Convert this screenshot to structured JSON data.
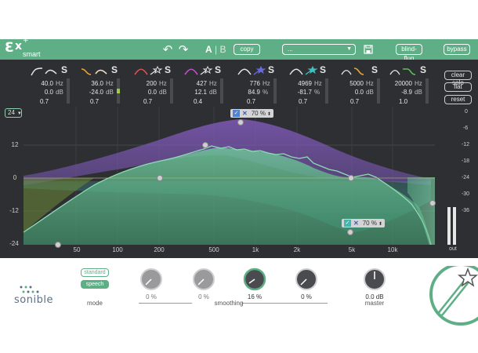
{
  "header": {
    "logo_text": "smart",
    "undo_icon": "undo-icon",
    "redo_icon": "redo-icon",
    "ab_a": "A",
    "ab_b": "B",
    "copy_label": "copy",
    "preset_value": "...",
    "save_icon": "save-icon",
    "blind_flug_label": "blind-flug",
    "bypass_label": "bypass",
    "accent_color": "#5faf86"
  },
  "bands": [
    {
      "type": "highpass-shelf",
      "color": "#e6e6e6",
      "solo": "S",
      "freq": "40.0",
      "freq_unit": "Hz",
      "gain": "0.0",
      "gain_unit": "dB",
      "q": "0.7"
    },
    {
      "type": "lowcut",
      "color": "#e8a838",
      "solo": "S",
      "freq": "36.0",
      "freq_unit": "Hz",
      "gain": "-24.0",
      "gain_unit": "dB",
      "q": "0.7"
    },
    {
      "type": "smart-bell",
      "color": "#e05050",
      "solo": "S",
      "freq": "200",
      "freq_unit": "Hz",
      "gain": "0.0",
      "gain_unit": "dB",
      "q": "0.7"
    },
    {
      "type": "smart-bell",
      "color": "#c050d0",
      "solo": "S",
      "freq": "427",
      "freq_unit": "Hz",
      "gain": "12.1",
      "gain_unit": "dB",
      "q": "0.4"
    },
    {
      "type": "smart-bell",
      "color": "#6a6ae0",
      "solo": "S",
      "freq": "776",
      "freq_unit": "Hz",
      "gain": "84.9",
      "gain_unit": "%",
      "q": "0.7"
    },
    {
      "type": "smart-bell",
      "color": "#40c0c0",
      "solo": "S",
      "freq": "4969",
      "freq_unit": "Hz",
      "gain": "-81.7",
      "gain_unit": "%",
      "q": "0.7"
    },
    {
      "type": "lowpass",
      "color": "#e8a838",
      "solo": "S",
      "freq": "5000",
      "freq_unit": "Hz",
      "gain": "0.0",
      "gain_unit": "dB",
      "q": "0.7"
    },
    {
      "type": "highshelf",
      "color": "#60c060",
      "solo": "S",
      "freq": "20000",
      "freq_unit": "Hz",
      "gain": "-8.9",
      "gain_unit": "dB",
      "q": "1.0"
    }
  ],
  "side_buttons": {
    "clear_solo": "clear solo",
    "flat": "flat",
    "reset": "reset"
  },
  "range_select": "24",
  "db_labels_left": [
    "12",
    "0",
    "-12",
    "-24"
  ],
  "db_labels_right": [
    "0",
    "-6",
    "-12",
    "-18",
    "-24",
    "-30",
    "-36"
  ],
  "freq_labels": [
    "50",
    "100",
    "200",
    "500",
    "1k",
    "2k",
    "5k",
    "10k"
  ],
  "out_label": "out",
  "smart_tags": [
    {
      "name": "upper",
      "pct": "70 %"
    },
    {
      "name": "lower",
      "pct": "70 %"
    }
  ],
  "bottom": {
    "brand": "sonible",
    "mode_standard": "standard",
    "mode_speech": "speech",
    "mode_label": "mode",
    "smoothing_label": "smoothing",
    "master_label": "master",
    "knob_values": [
      "0 %",
      "0 %",
      "16 %",
      "0 %"
    ],
    "master_value": "0.0 dB"
  }
}
